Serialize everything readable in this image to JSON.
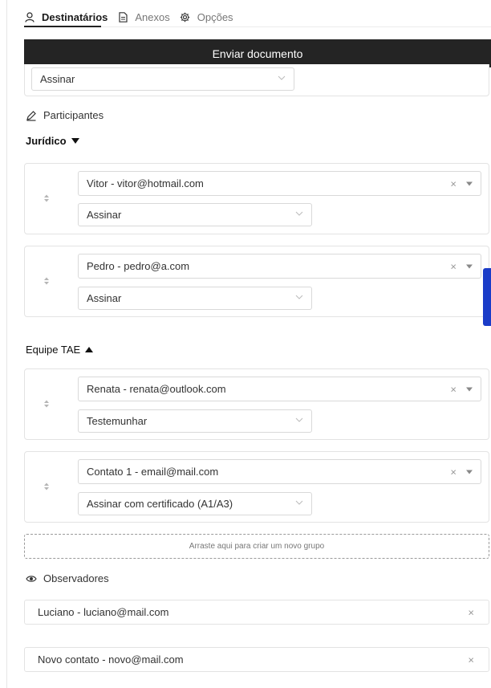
{
  "tabs": [
    {
      "label": "Destinatários",
      "icon": "user-icon",
      "active": true
    },
    {
      "label": "Anexos",
      "icon": "file-icon",
      "active": false
    },
    {
      "label": "Opções",
      "icon": "gear-icon",
      "active": false
    }
  ],
  "send_button": {
    "label": "Enviar documento"
  },
  "top_card": {
    "action": "Assinar"
  },
  "participants": {
    "label": "Participantes"
  },
  "groups": [
    {
      "name": "Jurídico",
      "expanded": false,
      "members": [
        {
          "contact": "Vitor - vitor@hotmail.com",
          "clear": "×",
          "action": "Assinar"
        },
        {
          "contact": "Pedro - pedro@a.com",
          "clear": "×",
          "action": "Assinar"
        }
      ]
    },
    {
      "name": "Equipe TAE",
      "expanded": true,
      "members": [
        {
          "contact": "Renata - renata@outlook.com",
          "clear": "×",
          "action": "Testemunhar"
        },
        {
          "contact": "Contato 1 - email@mail.com",
          "clear": "×",
          "action": "Assinar com certificado (A1/A3)"
        }
      ]
    }
  ],
  "dropzone": {
    "label": "Arraste aqui para criar um novo grupo"
  },
  "observers": {
    "label": "Observadores",
    "items": [
      {
        "contact": "Luciano - luciano@mail.com",
        "remove": "×"
      },
      {
        "contact": "Novo contato - novo@mail.com",
        "remove": "×"
      }
    ]
  },
  "colors": {
    "primary_button": "#242424",
    "side_handle": "#1a3cc8"
  }
}
